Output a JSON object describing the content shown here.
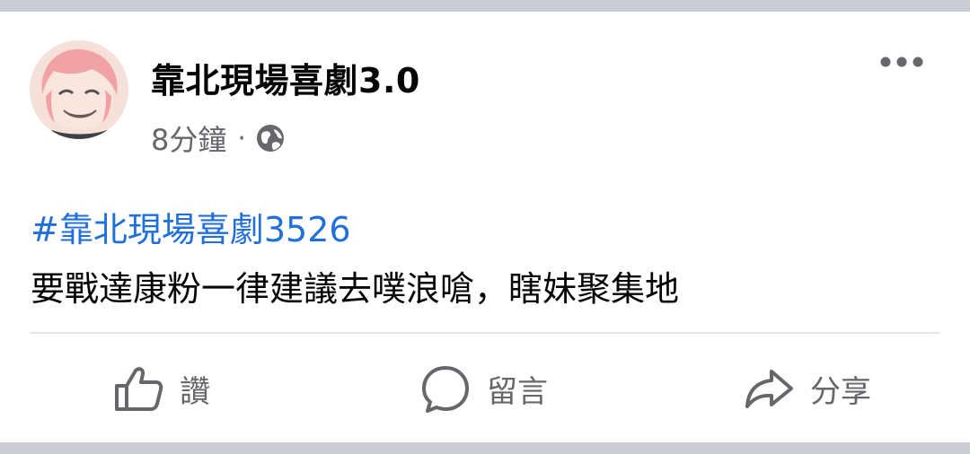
{
  "post": {
    "author": "靠北現場喜劇3.0",
    "time": "8分鐘",
    "separator": "·",
    "privacy_icon": "globe-icon",
    "more_icon": "more-options-icon",
    "hashtag": "#靠北現場喜劇3526",
    "text": "要戰達康粉一律建議去噗浪嗆，瞎妹聚集地"
  },
  "actions": {
    "like_label": "讚",
    "comment_label": "留言",
    "share_label": "分享"
  },
  "colors": {
    "link": "#216fdb",
    "muted": "#65676b",
    "background": "#c9ccd1"
  }
}
